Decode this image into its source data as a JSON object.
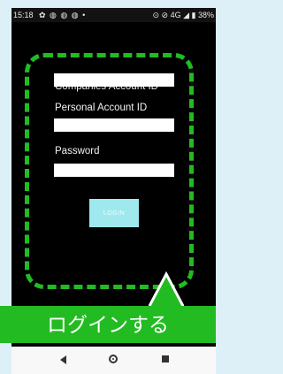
{
  "status_bar": {
    "time": "15:18",
    "left_icons": "✿ ◍ ◍ ◍  •",
    "right_text": "⊙ ⊘ 4G ◢ ▮ 38%"
  },
  "form": {
    "companies_label": "Companies Account ID",
    "companies_value": "",
    "personal_label": "Personal Account ID",
    "personal_value": "",
    "password_label": "Password",
    "password_value": "",
    "login_label": "LOGIN"
  },
  "callout": {
    "text": "ログインする"
  },
  "colors": {
    "accent_green": "#22bb22",
    "login_button": "#9fe8ee",
    "page_bg": "#ddf0f8"
  },
  "nav_icons": [
    "back-icon",
    "home-icon",
    "recent-apps-icon"
  ]
}
